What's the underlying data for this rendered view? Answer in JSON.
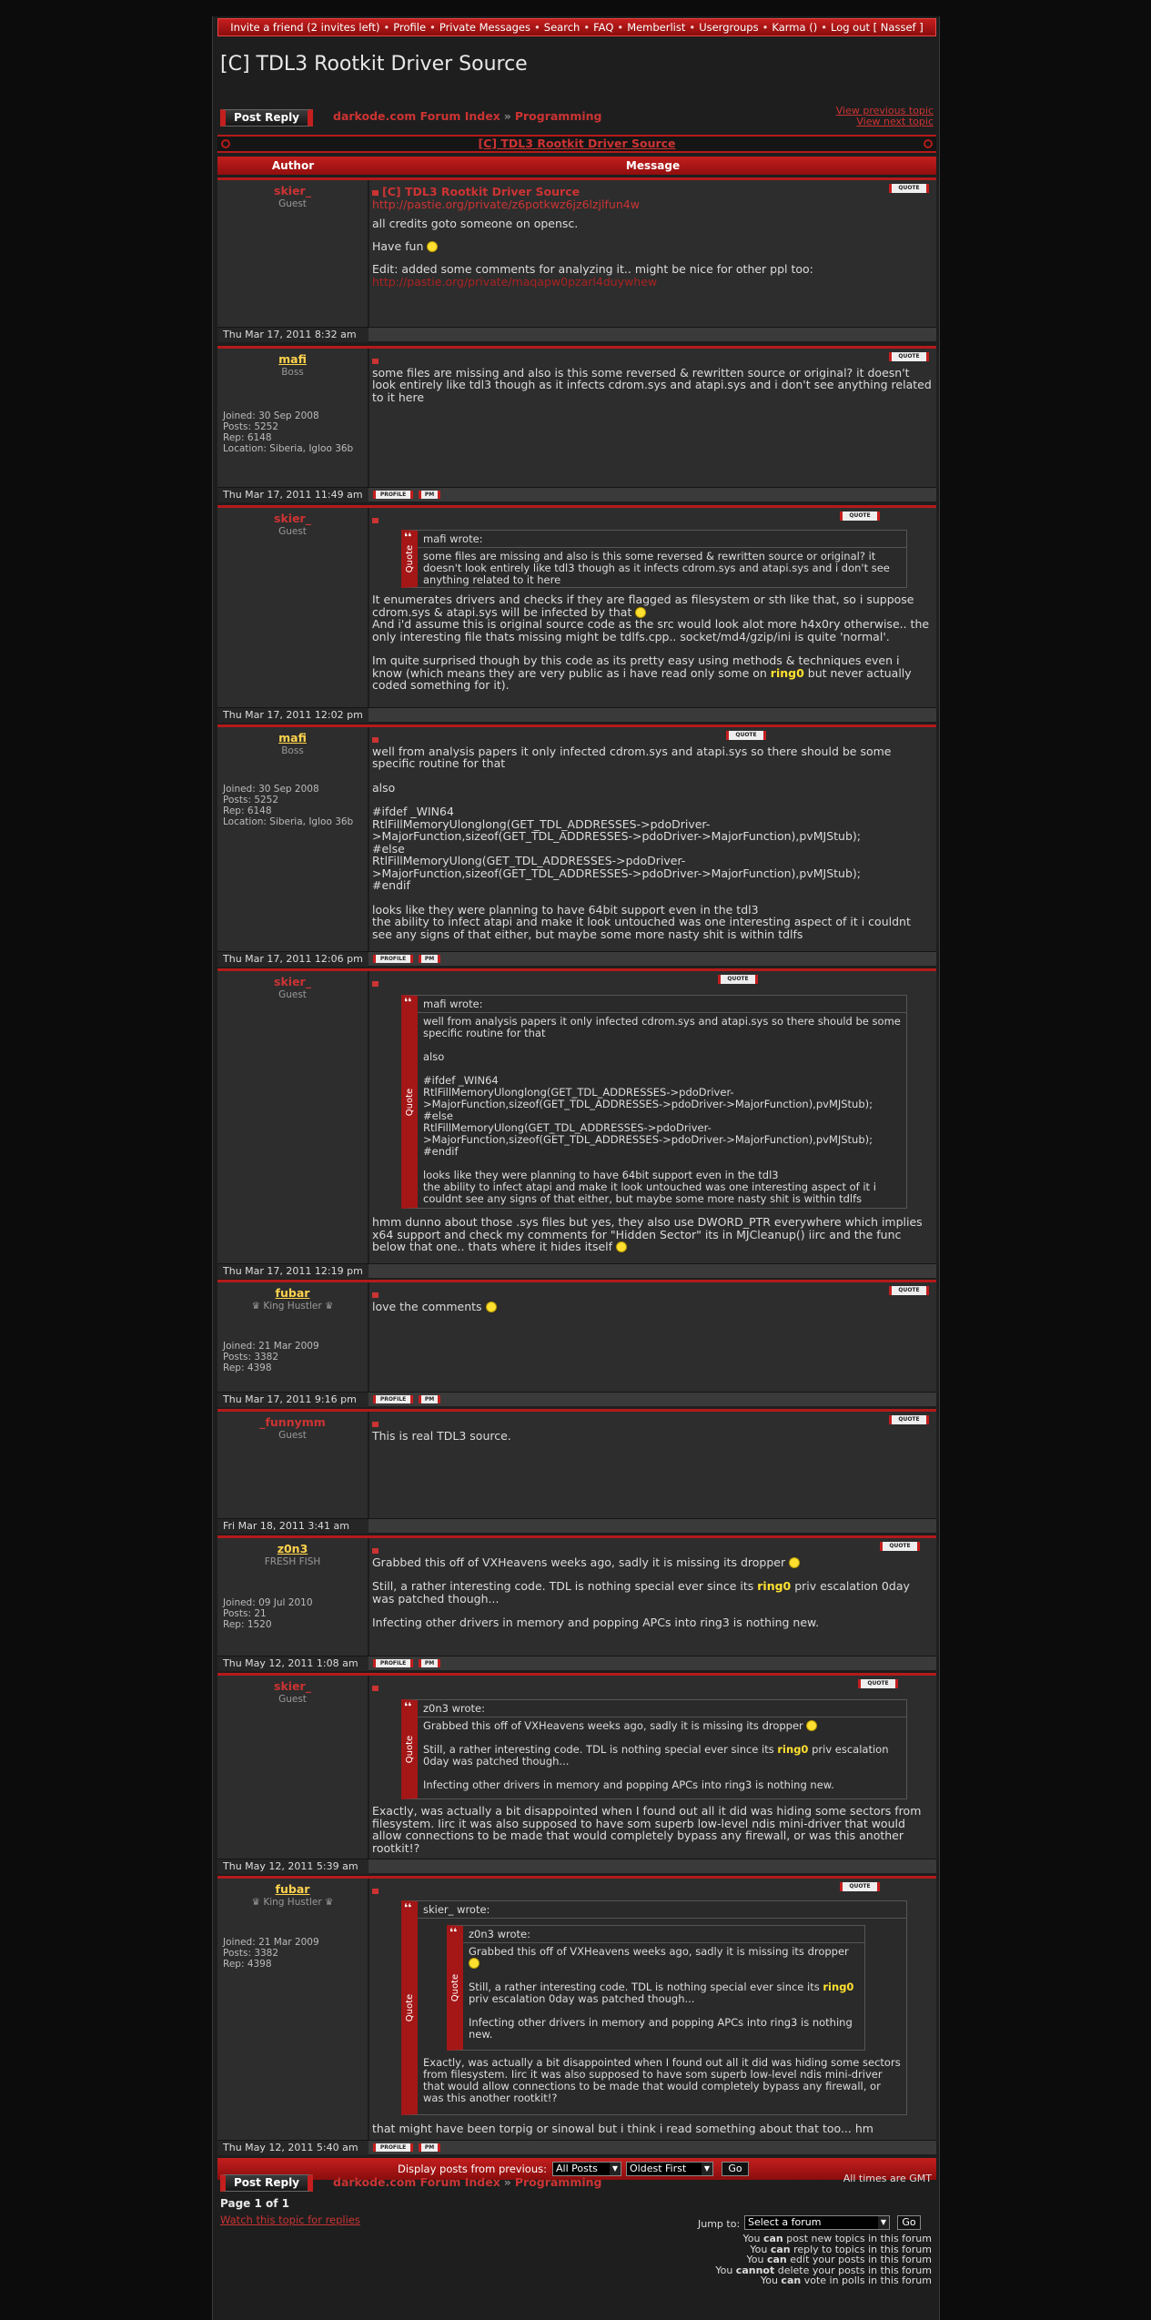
{
  "nav": {
    "items": [
      "Invite a friend (2 invites left)",
      "Profile",
      "Private Messages",
      "Search",
      "FAQ",
      "Memberlist",
      "Usergroups",
      "Karma ()",
      "Log out [ Nassef ]"
    ],
    "sep": "•"
  },
  "page_title": "[C] TDL3 Rootkit Driver Source",
  "post_reply_label": "Post Reply",
  "breadcrumb": {
    "forum_index": "darkode.com Forum Index",
    "arrow": "»",
    "forum": "Programming"
  },
  "view_previous": "View previous topic",
  "view_next": "View next topic",
  "topic_link": "[C] TDL3 Rootkit Driver Source",
  "table_header": {
    "author": "Author",
    "message": "Message"
  },
  "quote_label": "QUOTE",
  "profile_label": "PROFILE",
  "pm_label": "PM",
  "quote_side_label": "Quote",
  "posts": [
    {
      "author": "skier_",
      "rank": "Guest",
      "date": "Thu Mar 17, 2011 8:32 am",
      "title": "[C] TDL3 Rootkit Driver Source",
      "link1": "http://pastie.org/private/z6potkwz6jz6lzjlfun4w",
      "line1": "all credits goto someone on opensc.",
      "line2": "Have fun",
      "line3": "Edit: added some comments for analyzing it.. might be nice for other ppl too:",
      "link2": "http://pastie.org/private/maqapw0pzarl4duywhew"
    },
    {
      "author": "mafi",
      "rank": "Boss",
      "date": "Thu Mar 17, 2011 11:49 am",
      "stats": [
        "Joined: 30 Sep 2008",
        "Posts: 5252",
        "Rep: 6148",
        "Location: Siberia, Igloo 36b"
      ],
      "body": "some files are missing and also is this some reversed & rewritten source or original? it doesn't look entirely like tdl3 though as it infects cdrom.sys and atapi.sys and i don't see anything related to it here"
    },
    {
      "author": "skier_",
      "rank": "Guest",
      "date": "Thu Mar 17, 2011 12:02 pm",
      "quote_head": "mafi wrote:",
      "quote_body": "some files are missing and also is this some reversed & rewritten source or original? it doesn't look entirely like tdl3 though as it infects cdrom.sys and atapi.sys and i don't see anything related to it here",
      "body1": "It enumerates drivers and checks if they are flagged as filesystem or sth like that, so i suppose cdrom.sys & atapi.sys will be infected by that",
      "body2": "And i'd assume this is original source code as the src would look alot more h4x0ry otherwise.. the only interesting file thats missing might be tdlfs.cpp.. socket/md4/gzip/ini is quite 'normal'.",
      "body3a": "Im quite surprised though by this code as its pretty easy using methods & techniques even i know (which means they are very public as i have read only some on ",
      "body3hl": "ring0",
      "body3b": " but never actually coded something for it)."
    },
    {
      "author": "mafi",
      "rank": "Boss",
      "date": "Thu Mar 17, 2011 12:06 pm",
      "stats": [
        "Joined: 30 Sep 2008",
        "Posts: 5252",
        "Rep: 6148",
        "Location: Siberia, Igloo 36b"
      ],
      "l1": "well from analysis papers it only infected cdrom.sys and atapi.sys so there should be some specific routine for that",
      "l2": "also",
      "l3": "#ifdef _WIN64",
      "l4": "RtlFillMemoryUlonglong(GET_TDL_ADDRESSES->pdoDriver->MajorFunction,sizeof(GET_TDL_ADDRESSES->pdoDriver->MajorFunction),pvMJStub);",
      "l5": "#else",
      "l6": "RtlFillMemoryUlong(GET_TDL_ADDRESSES->pdoDriver->MajorFunction,sizeof(GET_TDL_ADDRESSES->pdoDriver->MajorFunction),pvMJStub);",
      "l7": "#endif",
      "l8": "looks like they were planning to have 64bit support even in the tdl3",
      "l9": "the ability to infect atapi and make it look untouched was one interesting aspect of it i couldnt see any signs of that either, but maybe some more nasty shit is within tdlfs"
    },
    {
      "author": "skier_",
      "rank": "Guest",
      "date": "Thu Mar 17, 2011 12:19 pm",
      "quote_head": "mafi wrote:",
      "q1": "well from analysis papers it only infected cdrom.sys and atapi.sys so there should be some specific routine for that",
      "q2": "also",
      "q3": "#ifdef _WIN64",
      "q4": "RtlFillMemoryUlonglong(GET_TDL_ADDRESSES->pdoDriver->MajorFunction,sizeof(GET_TDL_ADDRESSES->pdoDriver->MajorFunction),pvMJStub);",
      "q5": "#else",
      "q6": "RtlFillMemoryUlong(GET_TDL_ADDRESSES->pdoDriver->MajorFunction,sizeof(GET_TDL_ADDRESSES->pdoDriver->MajorFunction),pvMJStub);",
      "q7": "#endif",
      "q8": "looks like they were planning to have 64bit support even in the tdl3",
      "q9": "the ability to infect atapi and make it look untouched was one interesting aspect of it i couldnt see any signs of that either, but maybe some more nasty shit is within tdlfs",
      "body": "hmm dunno about those .sys files but yes, they also use DWORD_PTR everywhere which implies x64 support and check my comments for \"Hidden Sector\" its in MJCleanup() iirc and the func below that one.. thats where it hides itself"
    },
    {
      "author": "fubar",
      "rank": "♛ King Hustler ♛",
      "date": "Thu Mar 17, 2011 9:16 pm",
      "stats": [
        "Joined: 21 Mar 2009",
        "Posts: 3382",
        "Rep: 4398"
      ],
      "body": "love the comments"
    },
    {
      "author": "_funnymm",
      "rank": "Guest",
      "date": "Fri Mar 18, 2011 3:41 am",
      "body": "This is real TDL3 source."
    },
    {
      "author": "z0n3",
      "rank": "FRESH FISH",
      "date": "Thu May 12, 2011 1:08 am",
      "stats": [
        "Joined: 09 Jul 2010",
        "Posts: 21",
        "Rep: 1520"
      ],
      "b1": "Grabbed this off of VXHeavens weeks ago, sadly it is missing its dropper",
      "b2a": "Still, a rather interesting code. TDL is nothing special ever since its ",
      "b2hl": "ring0",
      "b2b": " priv escalation 0day was patched though...",
      "b3": "Infecting other drivers in memory and popping APCs into ring3 is nothing new."
    },
    {
      "author": "skier_",
      "rank": "Guest",
      "date": "Thu May 12, 2011 5:39 am",
      "quote_head": "z0n3 wrote:",
      "q1": "Grabbed this off of VXHeavens weeks ago, sadly it is missing its dropper",
      "q2a": "Still, a rather interesting code. TDL is nothing special ever since its ",
      "q2hl": "ring0",
      "q2b": " priv escalation 0day was patched though...",
      "q3": "Infecting other drivers in memory and popping APCs into ring3 is nothing new.",
      "body": "Exactly, was actually a bit disappointed when I found out all it did was hiding some sectors from filesystem. Iirc it was also supposed to have som superb low-level ndis mini-driver that would allow connections to be made that would completely bypass any firewall, or was this another rootkit!?"
    },
    {
      "author": "fubar",
      "rank": "♛ King Hustler ♛",
      "date": "Thu May 12, 2011 5:40 am",
      "stats": [
        "Joined: 21 Mar 2009",
        "Posts: 3382",
        "Rep: 4398"
      ],
      "outer_head": "skier_ wrote:",
      "inner_head": "z0n3 wrote:",
      "i1": "Grabbed this off of VXHeavens weeks ago, sadly it is missing its dropper",
      "i2a": "Still, a rather interesting code. TDL is nothing special ever since its ",
      "i2hl": "ring0",
      "i2b": " priv escalation 0day was patched though...",
      "i3": "Infecting other drivers in memory and popping APCs into ring3 is nothing new.",
      "o1": "Exactly, was actually a bit disappointed when I found out all it did was hiding some sectors from filesystem. Iirc it was also supposed to have som superb low-level ndis mini-driver that would allow connections to be made that would completely bypass any firewall, or was this another rootkit!?",
      "body": "that might have been torpig or sinowal but i think i read something about that too... hm"
    }
  ],
  "display": {
    "label": "Display posts from previous:",
    "posts_value": "All Posts",
    "order_value": "Oldest First",
    "go": "Go"
  },
  "times": "All times are GMT",
  "pagination": "Page 1 of 1",
  "watch": "Watch this topic for replies",
  "jump": {
    "label": "Jump to:",
    "value": "Select a forum",
    "go": "Go"
  },
  "perms": [
    [
      "You ",
      "can",
      " post new topics in this forum"
    ],
    [
      "You ",
      "can",
      " reply to topics in this forum"
    ],
    [
      "You ",
      "can",
      " edit your posts in this forum"
    ],
    [
      "You ",
      "cannot",
      " delete your posts in this forum"
    ],
    [
      "You ",
      "can",
      " vote in polls in this forum"
    ]
  ]
}
